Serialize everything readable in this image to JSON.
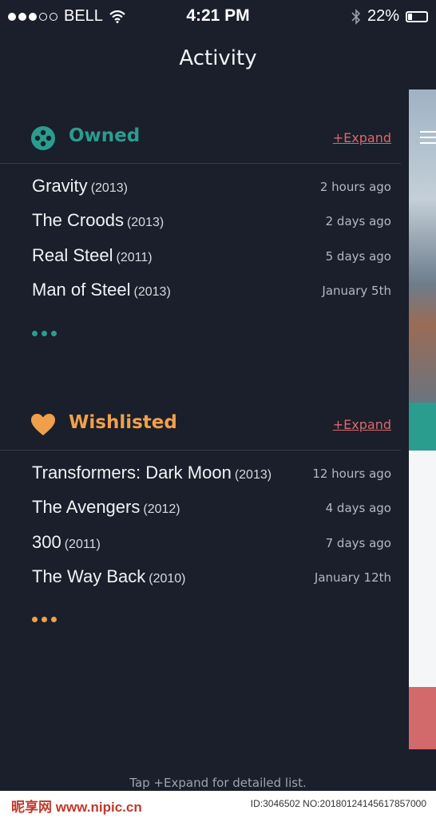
{
  "status": {
    "carrier": "BELL",
    "time": "4:21 PM",
    "battery": "22%",
    "battery_level": 0.22,
    "signal_bars": 3,
    "icons": [
      "signal-dots-icon",
      "wifi-icon",
      "bluetooth-icon",
      "battery-icon"
    ]
  },
  "page_title": "Activity",
  "owned": {
    "title": "Owned",
    "expand": "+Expand",
    "icon": "film-reel-icon",
    "color": "#2a9d8f",
    "items": [
      {
        "title": "Gravity",
        "year": "(2013)",
        "ago": "2 hours ago"
      },
      {
        "title": "The Croods",
        "year": "(2013)",
        "ago": "2 days ago"
      },
      {
        "title": "Real Steel",
        "year": "(2011)",
        "ago": "5 days ago"
      },
      {
        "title": "Man of Steel",
        "year": "(2013)",
        "ago": "January 5th"
      }
    ]
  },
  "wishlisted": {
    "title": "Wishlisted",
    "expand": "+Expand",
    "icon": "heart-icon",
    "color": "#f0a04b",
    "items": [
      {
        "title": "Transformers: Dark Moon",
        "year": "(2013)",
        "ago": "12 hours ago"
      },
      {
        "title": "The Avengers",
        "year": "(2012)",
        "ago": "4 days ago"
      },
      {
        "title": "300",
        "year": "(2011)",
        "ago": "7 days ago"
      },
      {
        "title": "The Way Back",
        "year": "(2010)",
        "ago": "January 12th"
      }
    ]
  },
  "hint": "Tap +Expand for detailed list.",
  "watermark": {
    "logo": "昵享网 www.nipic.cn",
    "id": "ID:3046502 NO:20180124145617857000"
  },
  "side_panel_icon": "menu-icon"
}
